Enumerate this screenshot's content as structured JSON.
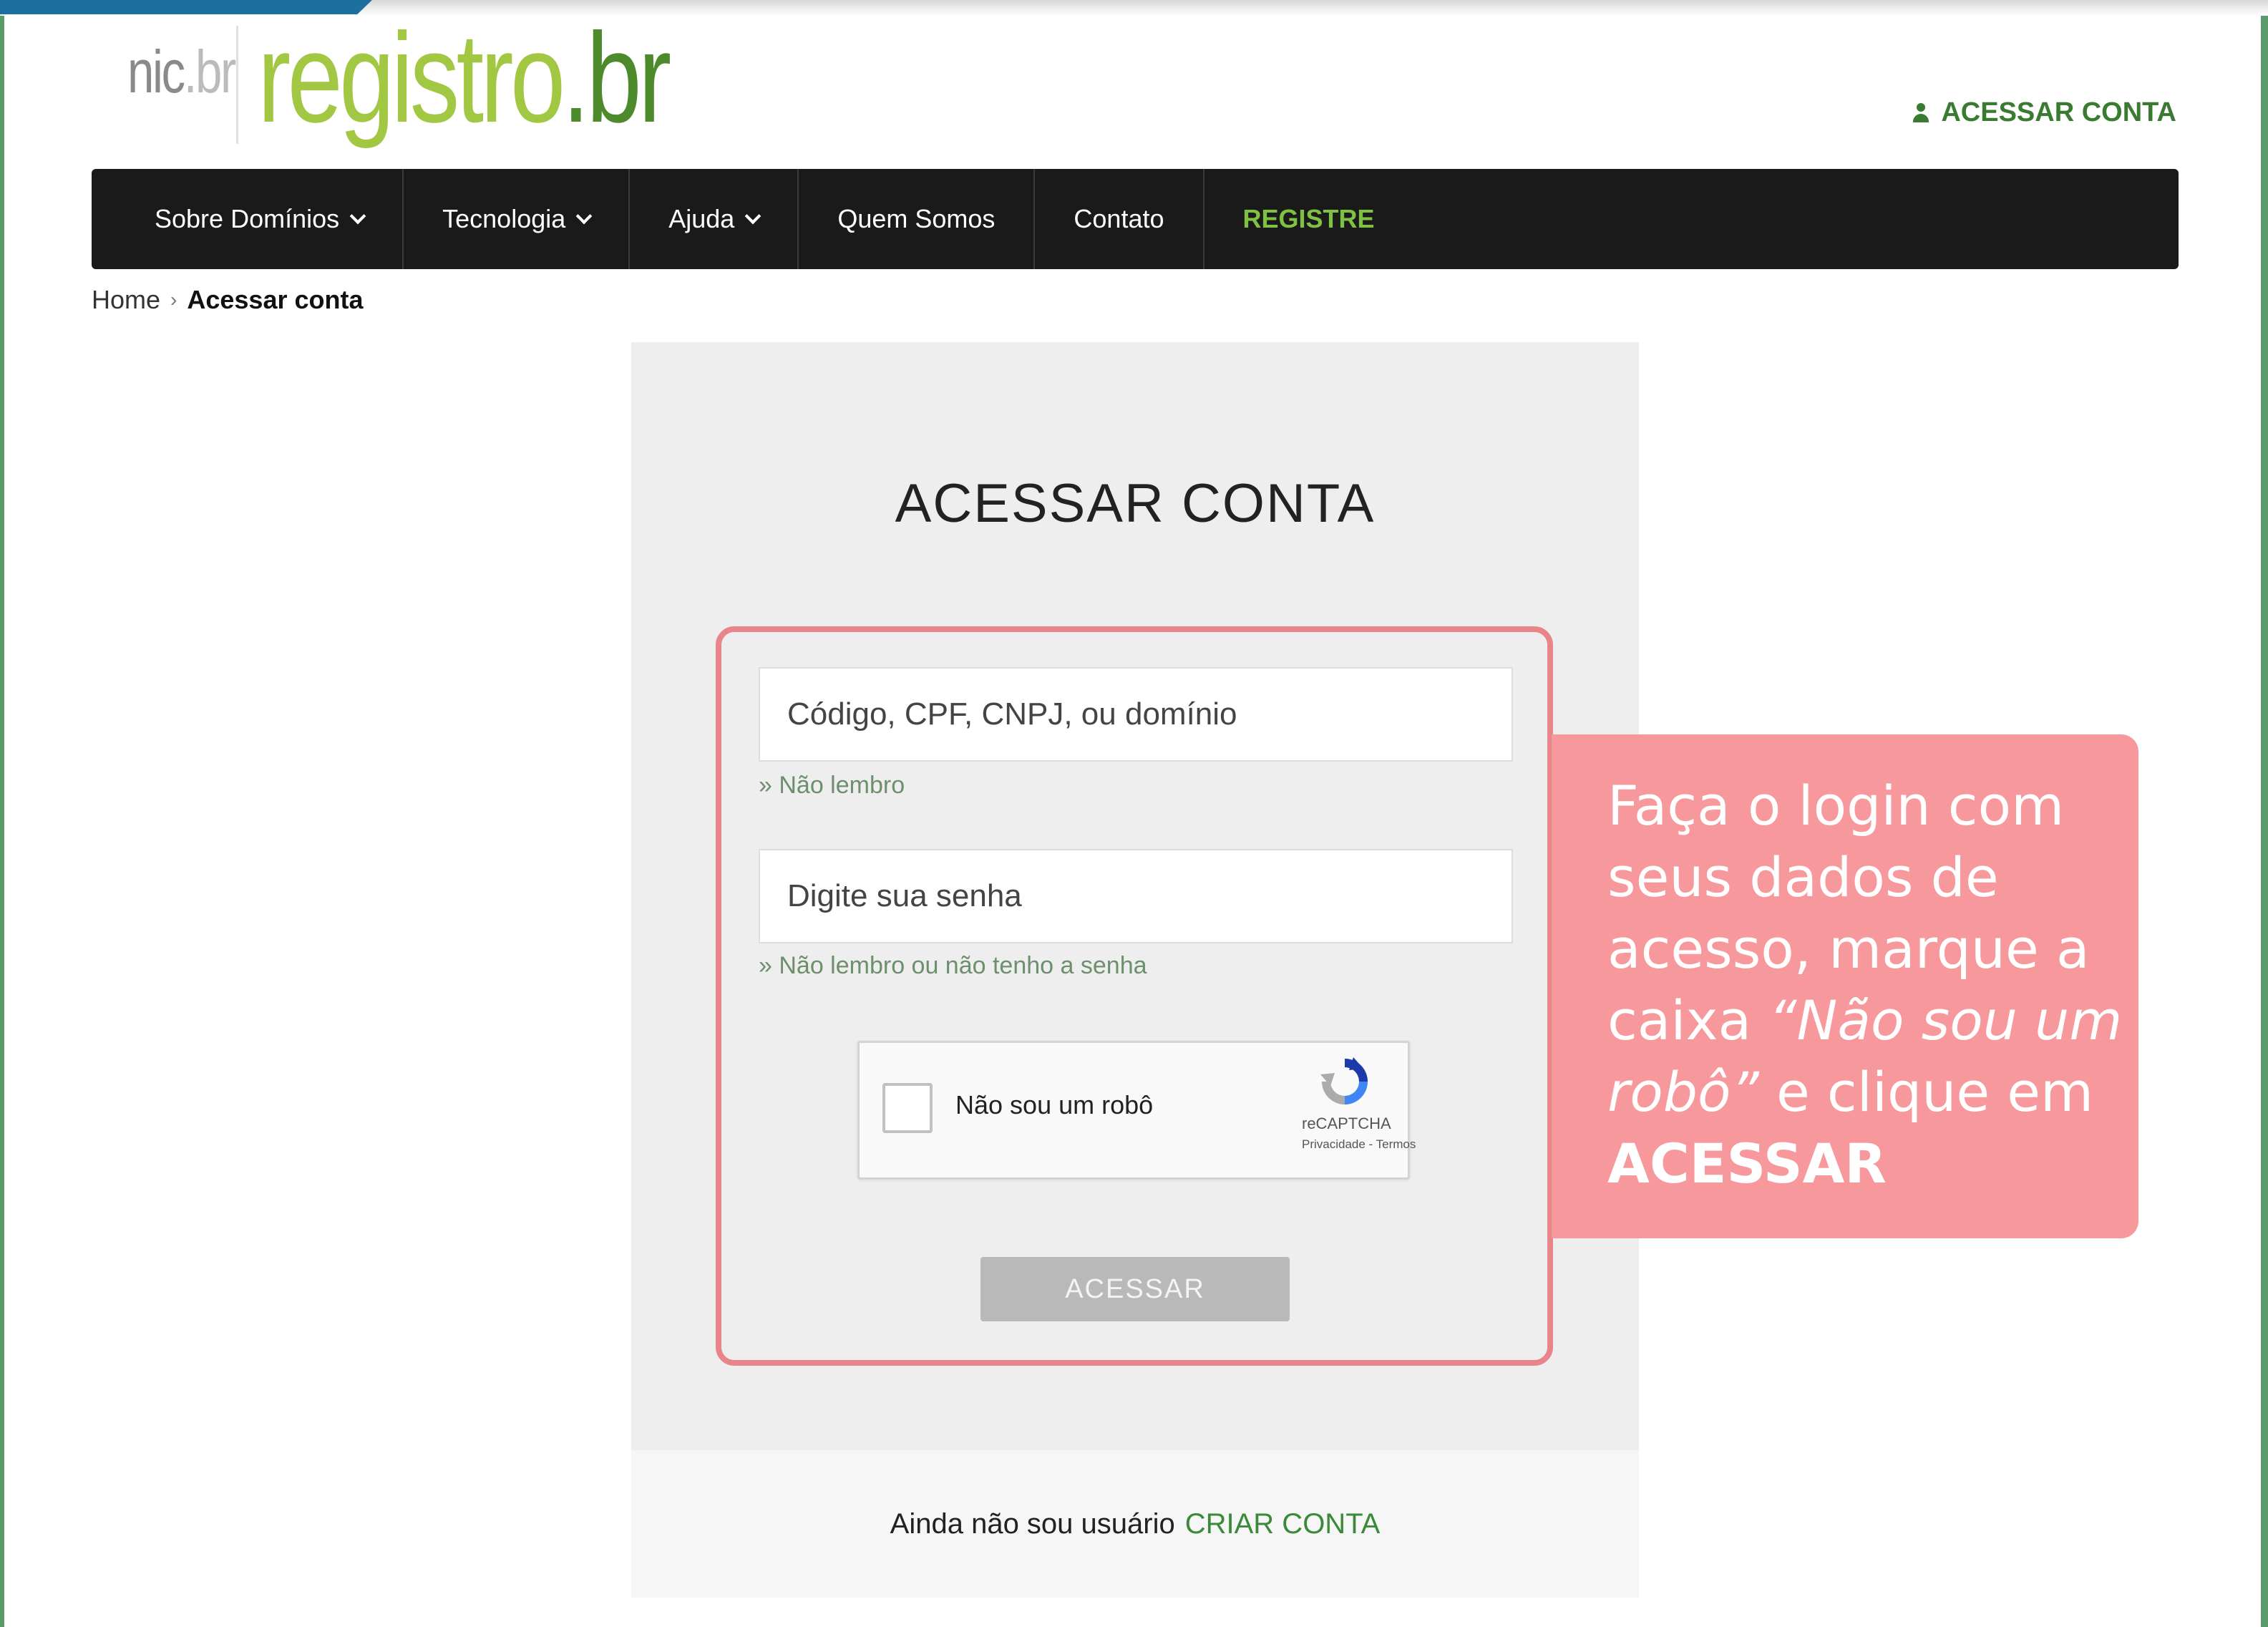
{
  "header": {
    "logo_nic": "nic",
    "logo_nic_tld": ".br",
    "logo_registro": "registro",
    "logo_registro_tld": ".br",
    "account_link": "ACESSAR CONTA"
  },
  "nav": {
    "items": [
      {
        "label": "Sobre Domínios"
      },
      {
        "label": "Tecnologia"
      },
      {
        "label": "Ajuda"
      },
      {
        "label": "Quem Somos"
      },
      {
        "label": "Contato"
      },
      {
        "label": "REGISTRE"
      }
    ]
  },
  "breadcrumb": {
    "home": "Home",
    "separator": "›",
    "current": "Acessar conta"
  },
  "login": {
    "title": "ACESSAR CONTA",
    "user_placeholder": "Código, CPF, CNPJ, ou domínio",
    "user_help": "» Não lembro",
    "password_placeholder": "Digite sua senha",
    "password_help": "» Não lembro ou não tenho a senha",
    "captcha_label": "Não sou um robô",
    "captcha_brand": "reCAPTCHA",
    "captcha_terms": "Privacidade - Termos",
    "submit_label": "ACESSAR",
    "footer_text": "Ainda não sou usuário",
    "footer_link": "CRIAR CONTA"
  },
  "callout": {
    "part1": "Faça o login com seus dados de acesso, marque a caixa ",
    "part2": "“Não sou um robô”",
    "part3": " e clique em ",
    "part4": "ACESSAR"
  },
  "colors": {
    "brand_green": "#a2c742",
    "dark_green": "#3a7b32",
    "navbar": "#1a1a1a",
    "highlight": "#e8858a",
    "callout": "#f7999c"
  },
  "icons": [
    "user-icon",
    "chevron-down-icon",
    "recaptcha-icon"
  ]
}
